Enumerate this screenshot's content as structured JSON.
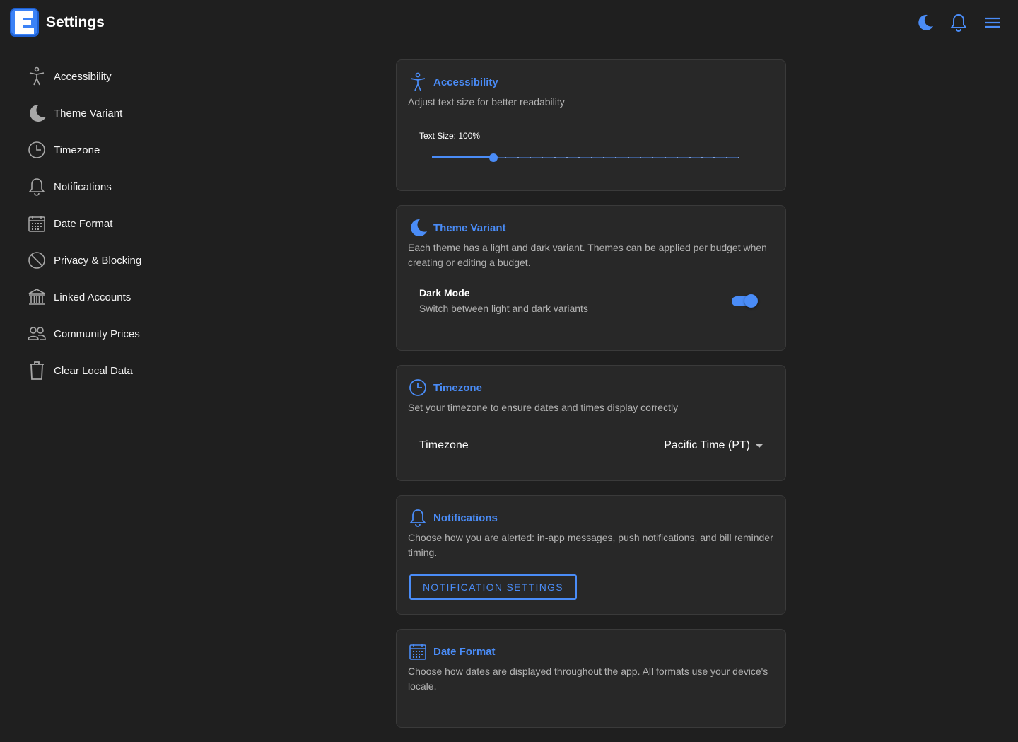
{
  "header": {
    "title": "Settings",
    "logo_letter": "E",
    "icons": [
      "moon-icon",
      "bell-icon",
      "menu-icon"
    ]
  },
  "sidebar": {
    "items": [
      {
        "label": "Accessibility",
        "icon": "accessibility-icon"
      },
      {
        "label": "Theme Variant",
        "icon": "moon-icon"
      },
      {
        "label": "Timezone",
        "icon": "clock-icon"
      },
      {
        "label": "Notifications",
        "icon": "bell-icon"
      },
      {
        "label": "Date Format",
        "icon": "calendar-icon"
      },
      {
        "label": "Privacy & Blocking",
        "icon": "block-icon"
      },
      {
        "label": "Linked Accounts",
        "icon": "bank-icon"
      },
      {
        "label": "Community Prices",
        "icon": "people-icon"
      },
      {
        "label": "Clear Local Data",
        "icon": "trash-icon"
      }
    ]
  },
  "cards": {
    "accessibility": {
      "title": "Accessibility",
      "description": "Adjust text size for better readability",
      "slider_label": "Text Size: 100%",
      "slider_value_fraction": 0.2,
      "slider_steps": 25
    },
    "theme": {
      "title": "Theme Variant",
      "description": "Each theme has a light and dark variant. Themes can be applied per budget when creating or editing a budget.",
      "toggle_title": "Dark Mode",
      "toggle_subtitle": "Switch between light and dark variants",
      "toggle_on": true
    },
    "timezone": {
      "title": "Timezone",
      "description": "Set your timezone to ensure dates and times display correctly",
      "field_label": "Timezone",
      "selected_value": "Pacific Time (PT)"
    },
    "notifications": {
      "title": "Notifications",
      "description": "Choose how you are alerted: in-app messages, push notifications, and bill reminder timing.",
      "button_label": "NOTIFICATION SETTINGS"
    },
    "date_format": {
      "title": "Date Format",
      "description": "Choose how dates are displayed throughout the app. All formats use your device's locale."
    }
  },
  "colors": {
    "accent": "#4a8cf7",
    "background": "#1f1f1f",
    "card": "#282828"
  }
}
